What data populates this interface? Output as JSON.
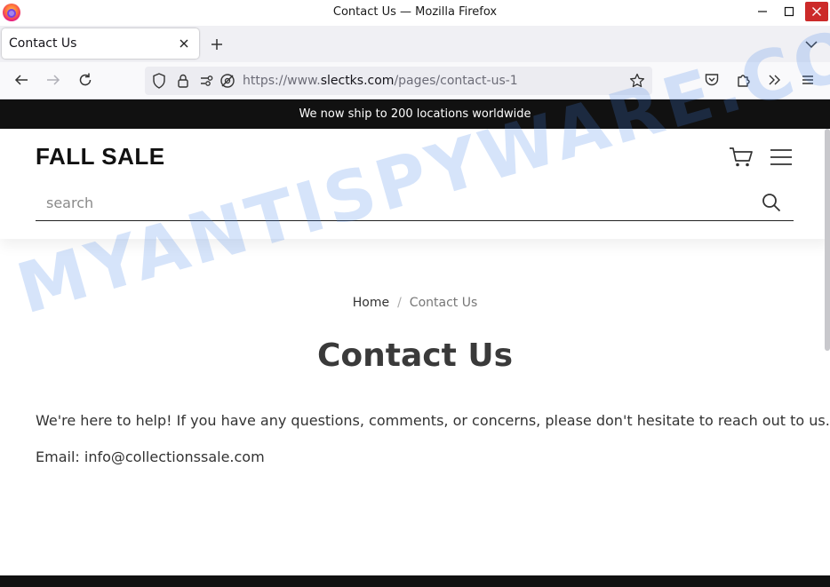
{
  "window": {
    "title": "Contact Us — Mozilla Firefox"
  },
  "tabs": [
    {
      "label": "Contact Us"
    }
  ],
  "navbar": {
    "url_prefix": "https://www.",
    "url_domain": "slectks.com",
    "url_path": "/pages/contact-us-1"
  },
  "page": {
    "announcement": "We now ship to 200 locations worldwide",
    "logo": "FALL SALE",
    "search": {
      "placeholder": "search"
    },
    "breadcrumb": {
      "home": "Home",
      "separator": "/",
      "current": "Contact Us"
    },
    "title": "Contact Us",
    "paragraph": "We're here to help! If you have any questions, comments, or concerns, please don't hesitate to reach out to us.",
    "email_line": "Email: info@collectionssale.com"
  },
  "watermark": "MYANTISPYWARE.COM",
  "colors": {
    "announcement_bg": "#111111",
    "close_button": "#cc2a29",
    "watermark": "#4682e6"
  }
}
